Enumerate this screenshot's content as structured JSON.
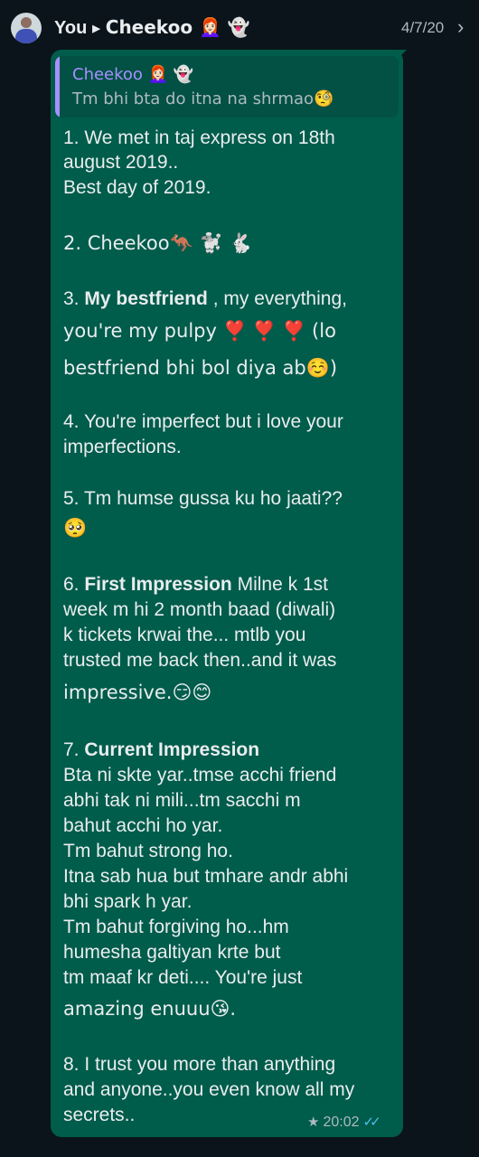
{
  "header": {
    "from": "You",
    "to": "Cheekoo 👩🏻‍🦰 👻",
    "date": "4/7/20"
  },
  "quoted": {
    "name": "Cheekoo 👩🏻‍🦰 👻",
    "text": "Tm bhi bta do itna na shrmao🧐"
  },
  "message": {
    "lines": [
      "1. We met in taj express on 18th",
      "august 2019..",
      "Best day of 2019.",
      "2. Cheekoo🦘 🐩 🐇",
      "3.",
      "My bestfriend",
      ", my everything,",
      "you're my pulpy ❣️ ❣️ ❣️ (lo",
      "bestfriend bhi bol diya ab☺️)",
      "4. You're imperfect but i love your",
      "imperfections.",
      "5. Tm humse gussa ku ho jaati??",
      "🥺",
      "6.",
      "First Impression",
      "Milne k 1st",
      "week m hi 2 month baad (diwali)",
      "k tickets krwai the... mtlb you",
      "trusted me back then..and it was",
      "impressive.😏😊",
      "7.",
      "Current Impression",
      "Bta ni skte yar..tmse acchi friend",
      "abhi tak ni mili...tm sacchi m",
      "bahut acchi ho yar.",
      "Tm bahut strong ho.",
      "Itna sab hua but tmhare andr abhi",
      "bhi spark h yar.",
      "Tm bahut forgiving ho...hm",
      "humesha galtiyan krte but",
      "tm maaf kr deti.... You're just",
      "amazing enuuu😘.",
      "8. I trust you more than anything",
      "and anyone..you even know all my",
      "secrets.."
    ],
    "time": "20:02",
    "starred": true,
    "status": "read"
  },
  "colors": {
    "background": "#0b141a",
    "bubble": "#005c4b",
    "quote_accent": "#a591ff",
    "read_ticks": "#53bdeb"
  }
}
